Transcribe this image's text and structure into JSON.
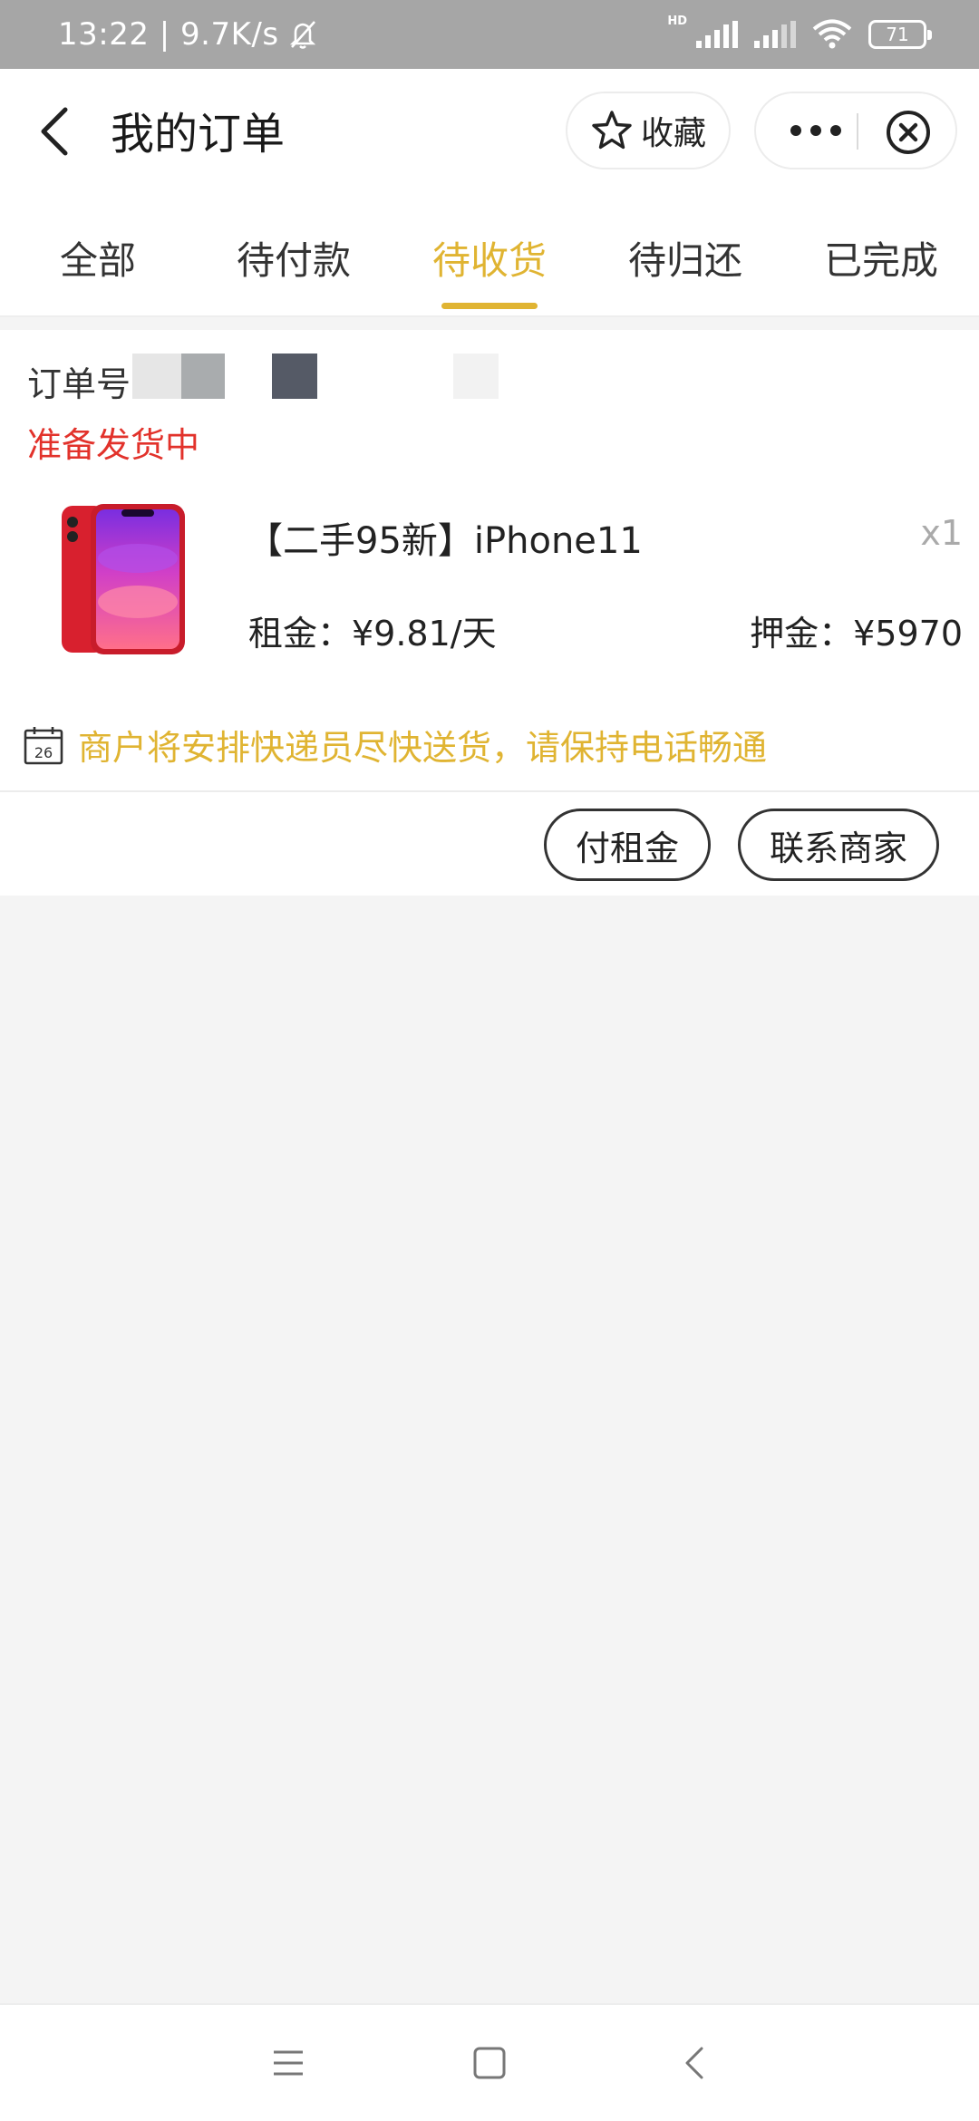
{
  "status_bar": {
    "time_speed": "13:22 | 9.7K/s",
    "battery": "71",
    "hd_label": "HD"
  },
  "header": {
    "title": "我的订单",
    "favorite_label": "收藏"
  },
  "tabs": [
    {
      "label": "全部",
      "active": false
    },
    {
      "label": "待付款",
      "active": false
    },
    {
      "label": "待收货",
      "active": true
    },
    {
      "label": "待归还",
      "active": false
    },
    {
      "label": "已完成",
      "active": false
    }
  ],
  "order": {
    "order_no_label": "订单号:",
    "status": "准备发货中",
    "product": {
      "name": "【二手95新】iPhone11",
      "quantity": "x1",
      "rent": "租金：¥9.81/天",
      "deposit": "押金：¥5970"
    },
    "notice": "商户将安排快递员尽快送货，请保持电话畅通",
    "calendar_day": "26",
    "buttons": {
      "pay_rent": "付租金",
      "contact_merchant": "联系商家"
    }
  },
  "colors": {
    "accent": "#e0b432",
    "status_red": "#e2322b",
    "status_bar_bg": "#a6a6a6",
    "page_bg": "#f4f4f4"
  },
  "icons": [
    "back-arrow-icon",
    "star-icon",
    "more-dots-icon",
    "close-circle-icon",
    "calendar-icon",
    "bell-muted-icon",
    "signal-icon",
    "wifi-icon",
    "battery-icon",
    "menu-icon",
    "home-square-icon",
    "back-chevron-icon"
  ]
}
